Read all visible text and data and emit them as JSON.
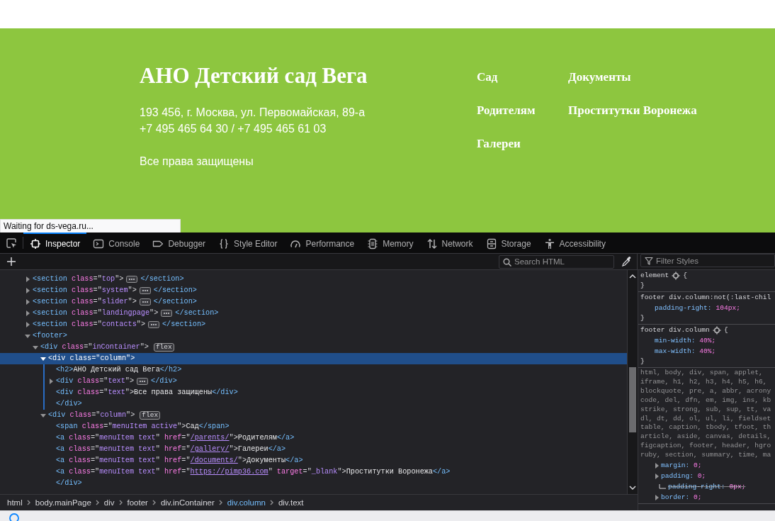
{
  "site_footer": {
    "title": "АНО Детский сад Вега",
    "address_lines": [
      "193 456, г. Москва, ул. Первомайская, 89-а",
      "+7 495 465 64 30 / +7 495 465 61 03"
    ],
    "rights": "Все права защищены",
    "menu": [
      {
        "label": "Сад"
      },
      {
        "label": "Родителям"
      },
      {
        "label": "Галереи"
      },
      {
        "label": "Документы"
      },
      {
        "label": "Проститутки Воронежа"
      }
    ]
  },
  "status_tooltip": "Waiting for ds-vega.ru...",
  "devtools": {
    "tabs": [
      {
        "label": "Inspector",
        "selected": true
      },
      {
        "label": "Console",
        "selected": false
      },
      {
        "label": "Debugger",
        "selected": false
      },
      {
        "label": "Style Editor",
        "selected": false
      },
      {
        "label": "Performance",
        "selected": false
      },
      {
        "label": "Memory",
        "selected": false
      },
      {
        "label": "Network",
        "selected": false
      },
      {
        "label": "Storage",
        "selected": false
      },
      {
        "label": "Accessibility",
        "selected": false
      }
    ],
    "search_html": {
      "placeholder": "Search HTML"
    },
    "filter_styles": {
      "placeholder": "Filter Styles"
    },
    "markup": [
      {
        "kind": "toggle",
        "expanded": false,
        "selected": false,
        "tokens": [
          {
            "kind": "tag",
            "text": "<section "
          },
          {
            "kind": "attr",
            "text": "class"
          },
          {
            "kind": "punct",
            "text": "=\""
          },
          {
            "kind": "value",
            "text": "top"
          },
          {
            "kind": "punct",
            "text": "\">"
          },
          {
            "kind": "more"
          },
          {
            "kind": "tag",
            "text": "</section>"
          }
        ]
      },
      {
        "kind": "toggle",
        "expanded": false,
        "selected": false,
        "tokens": [
          {
            "kind": "tag",
            "text": "<section "
          },
          {
            "kind": "attr",
            "text": "class"
          },
          {
            "kind": "punct",
            "text": "=\""
          },
          {
            "kind": "value",
            "text": "system"
          },
          {
            "kind": "punct",
            "text": "\">"
          },
          {
            "kind": "more"
          },
          {
            "kind": "tag",
            "text": "</section>"
          }
        ]
      },
      {
        "kind": "toggle",
        "expanded": false,
        "selected": false,
        "tokens": [
          {
            "kind": "tag",
            "text": "<section "
          },
          {
            "kind": "attr",
            "text": "class"
          },
          {
            "kind": "punct",
            "text": "=\""
          },
          {
            "kind": "value",
            "text": "slider"
          },
          {
            "kind": "punct",
            "text": "\">"
          },
          {
            "kind": "more"
          },
          {
            "kind": "tag",
            "text": "</section>"
          }
        ]
      },
      {
        "kind": "toggle",
        "expanded": false,
        "selected": false,
        "tokens": [
          {
            "kind": "tag",
            "text": "<section "
          },
          {
            "kind": "attr",
            "text": "class"
          },
          {
            "kind": "punct",
            "text": "=\""
          },
          {
            "kind": "value",
            "text": "landingpage"
          },
          {
            "kind": "punct",
            "text": "\">"
          },
          {
            "kind": "more"
          },
          {
            "kind": "tag",
            "text": "</section>"
          }
        ]
      },
      {
        "kind": "toggle",
        "expanded": false,
        "selected": false,
        "tokens": [
          {
            "kind": "tag",
            "text": "<section "
          },
          {
            "kind": "attr",
            "text": "class"
          },
          {
            "kind": "punct",
            "text": "=\""
          },
          {
            "kind": "value",
            "text": "contacts"
          },
          {
            "kind": "punct",
            "text": "\">"
          },
          {
            "kind": "more"
          },
          {
            "kind": "tag",
            "text": "</section>"
          }
        ]
      },
      {
        "kind": "toggle",
        "expanded": true,
        "selected": false,
        "tokens": [
          {
            "kind": "tag",
            "text": "<footer>"
          }
        ],
        "children": [
          {
            "kind": "toggle",
            "expanded": true,
            "selected": false,
            "tokens": [
              {
                "kind": "tag",
                "text": "<div "
              },
              {
                "kind": "attr",
                "text": "class"
              },
              {
                "kind": "punct",
                "text": "=\""
              },
              {
                "kind": "value",
                "text": "inContainer"
              },
              {
                "kind": "punct",
                "text": "\">"
              },
              {
                "kind": "badge",
                "text": "flex"
              }
            ],
            "children": [
              {
                "kind": "toggle",
                "expanded": true,
                "selected": true,
                "tokens": [
                  {
                    "kind": "tag",
                    "text": "<div "
                  },
                  {
                    "kind": "attr",
                    "text": "class"
                  },
                  {
                    "kind": "punct",
                    "text": "=\""
                  },
                  {
                    "kind": "value",
                    "text": "column"
                  },
                  {
                    "kind": "punct",
                    "text": "\">"
                  }
                ],
                "children": [
                  {
                    "kind": "leaf",
                    "selected": false,
                    "tokens": [
                      {
                        "kind": "tag",
                        "text": "<h2>"
                      },
                      {
                        "kind": "text",
                        "text": "АНО Детский сад Вега"
                      },
                      {
                        "kind": "tag",
                        "text": "</h2>"
                      }
                    ]
                  },
                  {
                    "kind": "toggle",
                    "expanded": false,
                    "selected": false,
                    "tokens": [
                      {
                        "kind": "tag",
                        "text": "<div "
                      },
                      {
                        "kind": "attr",
                        "text": "class"
                      },
                      {
                        "kind": "punct",
                        "text": "=\""
                      },
                      {
                        "kind": "value",
                        "text": "text"
                      },
                      {
                        "kind": "punct",
                        "text": "\">"
                      },
                      {
                        "kind": "more"
                      },
                      {
                        "kind": "tag",
                        "text": "</div>"
                      }
                    ]
                  },
                  {
                    "kind": "leaf",
                    "selected": false,
                    "tokens": [
                      {
                        "kind": "tag",
                        "text": "<div "
                      },
                      {
                        "kind": "attr",
                        "text": "class"
                      },
                      {
                        "kind": "punct",
                        "text": "=\""
                      },
                      {
                        "kind": "value",
                        "text": "text"
                      },
                      {
                        "kind": "punct",
                        "text": "\">"
                      },
                      {
                        "kind": "text",
                        "text": "Все права защищены"
                      },
                      {
                        "kind": "tag",
                        "text": "</div>"
                      }
                    ]
                  },
                  {
                    "kind": "close",
                    "selected": false,
                    "tokens": [
                      {
                        "kind": "tag",
                        "text": "</div>"
                      }
                    ]
                  }
                ]
              },
              {
                "kind": "toggle",
                "expanded": true,
                "selected": false,
                "tokens": [
                  {
                    "kind": "tag",
                    "text": "<div "
                  },
                  {
                    "kind": "attr",
                    "text": "class"
                  },
                  {
                    "kind": "punct",
                    "text": "=\""
                  },
                  {
                    "kind": "value",
                    "text": "column"
                  },
                  {
                    "kind": "punct",
                    "text": "\">"
                  },
                  {
                    "kind": "badge",
                    "text": "flex"
                  }
                ],
                "children": [
                  {
                    "kind": "leaf",
                    "selected": false,
                    "tokens": [
                      {
                        "kind": "tag",
                        "text": "<span "
                      },
                      {
                        "kind": "attr",
                        "text": "class"
                      },
                      {
                        "kind": "punct",
                        "text": "=\""
                      },
                      {
                        "kind": "value",
                        "text": "menuItem active"
                      },
                      {
                        "kind": "punct",
                        "text": "\">"
                      },
                      {
                        "kind": "text",
                        "text": "Сад"
                      },
                      {
                        "kind": "tag",
                        "text": "</span>"
                      }
                    ]
                  },
                  {
                    "kind": "leaf",
                    "selected": false,
                    "tokens": [
                      {
                        "kind": "tag",
                        "text": "<a "
                      },
                      {
                        "kind": "attr",
                        "text": "class"
                      },
                      {
                        "kind": "punct",
                        "text": "=\""
                      },
                      {
                        "kind": "value",
                        "text": "menuItem text"
                      },
                      {
                        "kind": "punct",
                        "text": "\" "
                      },
                      {
                        "kind": "attr",
                        "text": "href"
                      },
                      {
                        "kind": "punct",
                        "text": "=\""
                      },
                      {
                        "kind": "link",
                        "text": "/parents/"
                      },
                      {
                        "kind": "punct",
                        "text": "\">"
                      },
                      {
                        "kind": "text",
                        "text": "Родителям"
                      },
                      {
                        "kind": "tag",
                        "text": "</a>"
                      }
                    ]
                  },
                  {
                    "kind": "leaf",
                    "selected": false,
                    "tokens": [
                      {
                        "kind": "tag",
                        "text": "<a "
                      },
                      {
                        "kind": "attr",
                        "text": "class"
                      },
                      {
                        "kind": "punct",
                        "text": "=\""
                      },
                      {
                        "kind": "value",
                        "text": "menuItem text"
                      },
                      {
                        "kind": "punct",
                        "text": "\" "
                      },
                      {
                        "kind": "attr",
                        "text": "href"
                      },
                      {
                        "kind": "punct",
                        "text": "=\""
                      },
                      {
                        "kind": "link",
                        "text": "/gallery/"
                      },
                      {
                        "kind": "punct",
                        "text": "\">"
                      },
                      {
                        "kind": "text",
                        "text": "Галереи"
                      },
                      {
                        "kind": "tag",
                        "text": "</a>"
                      }
                    ]
                  },
                  {
                    "kind": "leaf",
                    "selected": false,
                    "tokens": [
                      {
                        "kind": "tag",
                        "text": "<a "
                      },
                      {
                        "kind": "attr",
                        "text": "class"
                      },
                      {
                        "kind": "punct",
                        "text": "=\""
                      },
                      {
                        "kind": "value",
                        "text": "menuItem text"
                      },
                      {
                        "kind": "punct",
                        "text": "\" "
                      },
                      {
                        "kind": "attr",
                        "text": "href"
                      },
                      {
                        "kind": "punct",
                        "text": "=\""
                      },
                      {
                        "kind": "link",
                        "text": "/documents/"
                      },
                      {
                        "kind": "punct",
                        "text": "\">"
                      },
                      {
                        "kind": "text",
                        "text": "Документы"
                      },
                      {
                        "kind": "tag",
                        "text": "</a>"
                      }
                    ]
                  },
                  {
                    "kind": "leaf",
                    "selected": false,
                    "tokens": [
                      {
                        "kind": "tag",
                        "text": "<a "
                      },
                      {
                        "kind": "attr",
                        "text": "class"
                      },
                      {
                        "kind": "punct",
                        "text": "=\""
                      },
                      {
                        "kind": "value",
                        "text": "menuItem text"
                      },
                      {
                        "kind": "punct",
                        "text": "\" "
                      },
                      {
                        "kind": "attr",
                        "text": "href"
                      },
                      {
                        "kind": "punct",
                        "text": "=\""
                      },
                      {
                        "kind": "link",
                        "text": "https://pimp36.com"
                      },
                      {
                        "kind": "punct",
                        "text": "\" "
                      },
                      {
                        "kind": "attr",
                        "text": "target"
                      },
                      {
                        "kind": "punct",
                        "text": "=\""
                      },
                      {
                        "kind": "value",
                        "text": "_blank"
                      },
                      {
                        "kind": "punct",
                        "text": "\">"
                      },
                      {
                        "kind": "text",
                        "text": "Проститутки Воронежа"
                      },
                      {
                        "kind": "tag",
                        "text": "</a>"
                      }
                    ]
                  },
                  {
                    "kind": "close",
                    "selected": false,
                    "tokens": [
                      {
                        "kind": "tag",
                        "text": "</div>"
                      }
                    ]
                  }
                ]
              }
            ]
          }
        ]
      }
    ],
    "rules": [
      {
        "selector_lines": [
          "element"
        ],
        "gear": true,
        "open": "{",
        "close": "}"
      },
      {
        "selector_lines": [
          "footer div.column:not(:last-chil"
        ],
        "gear": false,
        "close": "}",
        "declarations": [
          {
            "name": "padding-right:",
            "value": "104px;",
            "expandable": false,
            "overridden": false
          }
        ]
      },
      {
        "selector_lines": [
          "footer div.column"
        ],
        "gear": true,
        "open": "{",
        "close": "}",
        "declarations": [
          {
            "name": "min-width:",
            "value": "40%;",
            "expandable": false,
            "overridden": false
          },
          {
            "name": "max-width:",
            "value": "40%;",
            "expandable": false,
            "overridden": false
          }
        ]
      },
      {
        "selector_lines": [
          "html, body, div, span, applet,",
          "iframe, h1, h2, h3, h4, h5, h6,",
          "blockquote, pre, a, abbr, acrony",
          "code, del, dfn, em, img, ins, kb",
          "strike, strong, sub, sup, tt, va",
          "dl, dt, dd, ol, ul, li, fieldset",
          "table, caption, tbody, tfoot, th",
          "article, aside, canvas, details,",
          "figcaption, footer, header, hgro",
          "ruby, section, summary, time, ma"
        ],
        "gear": false,
        "declarations": [
          {
            "name": "margin:",
            "value": "0;",
            "expandable": true,
            "overridden": false
          },
          {
            "name": "padding:",
            "value": "0;",
            "expandable": true,
            "overridden": false,
            "children": [
              {
                "name": "padding-right:",
                "value": "0px;",
                "expandable": false,
                "overridden": true
              }
            ]
          },
          {
            "name": "border:",
            "value": "0;",
            "expandable": true,
            "overridden": false
          }
        ]
      }
    ],
    "breadcrumbs": [
      {
        "label": "html",
        "selected": false
      },
      {
        "label": "body.mainPage",
        "selected": false
      },
      {
        "label": "div",
        "selected": false
      },
      {
        "label": "footer",
        "selected": false
      },
      {
        "label": "div.inContainer",
        "selected": false
      },
      {
        "label": "div.column",
        "selected": true
      },
      {
        "label": "div.text",
        "selected": false
      }
    ]
  }
}
